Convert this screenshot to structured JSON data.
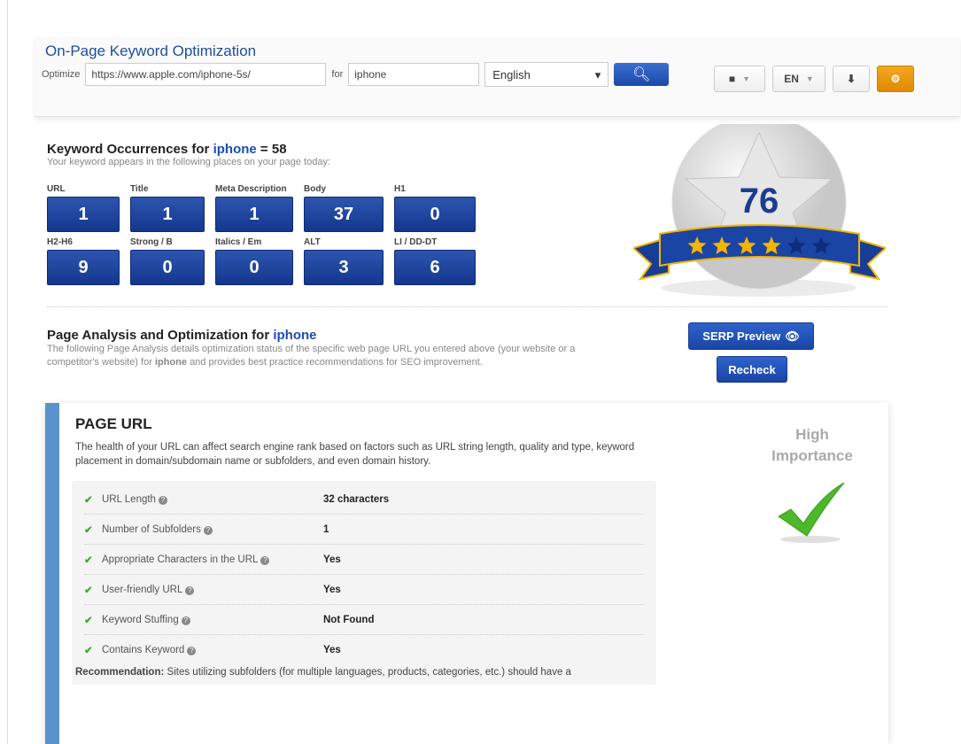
{
  "header": {
    "title": "On-Page Keyword Optimization",
    "optimize_label": "Optimize",
    "url_value": "https://www.apple.com/iphone-5s/",
    "for_label": "for",
    "keyword_value": "iphone",
    "language": "English"
  },
  "toolbar": {
    "language_code": "EN"
  },
  "occurrences": {
    "title_prefix": "Keyword Occurrences for",
    "keyword": "iphone",
    "equals": "= 58",
    "subtitle": "Your keyword appears in the following places on your page today:",
    "items": [
      {
        "label": "URL",
        "value": "1"
      },
      {
        "label": "Title",
        "value": "1"
      },
      {
        "label": "Meta Description",
        "value": "1"
      },
      {
        "label": "Body",
        "value": "37"
      },
      {
        "label": "H1",
        "value": "0"
      },
      {
        "label": "H2-H6",
        "value": "9"
      },
      {
        "label": "Strong / B",
        "value": "0"
      },
      {
        "label": "Italics / Em",
        "value": "0"
      },
      {
        "label": "ALT",
        "value": "3"
      },
      {
        "label": "LI / DD-DT",
        "value": "6"
      }
    ]
  },
  "score": {
    "value": "76",
    "stars_filled": 4,
    "stars_total": 6,
    "colors": {
      "gold": "#f5b400",
      "dark": "#0d2d7a",
      "ribbon": "#1a45a5"
    }
  },
  "analysis": {
    "title_prefix": "Page Analysis and Optimization for",
    "keyword": "iphone",
    "desc_1": "The following Page Analysis details optimization status of the specific web page URL you entered above (your website or a competitor's website) for",
    "desc_kw": "iphone",
    "desc_2": "and provides best practice recommendations for SEO improvement.",
    "serp_button": "SERP Preview",
    "recheck_button": "Recheck"
  },
  "page_url": {
    "title": "PAGE URL",
    "description": "The health of your URL can affect search engine rank based on factors such as URL string length, quality and type, keyword placement in domain/subdomain name or subfolders, and even domain history.",
    "rows": [
      {
        "name": "URL Length",
        "value": "32 characters"
      },
      {
        "name": "Number of Subfolders",
        "value": "1"
      },
      {
        "name": "Appropriate Characters in the URL",
        "value": "Yes"
      },
      {
        "name": "User-friendly URL",
        "value": "Yes"
      },
      {
        "name": "Keyword Stuffing",
        "value": "Not Found"
      },
      {
        "name": "Contains Keyword",
        "value": "Yes"
      }
    ],
    "recommendation_label": "Recommendation:",
    "recommendation_text": "Sites utilizing subfolders (for multiple languages, products, categories, etc.) should have a",
    "importance": "High Importance"
  }
}
